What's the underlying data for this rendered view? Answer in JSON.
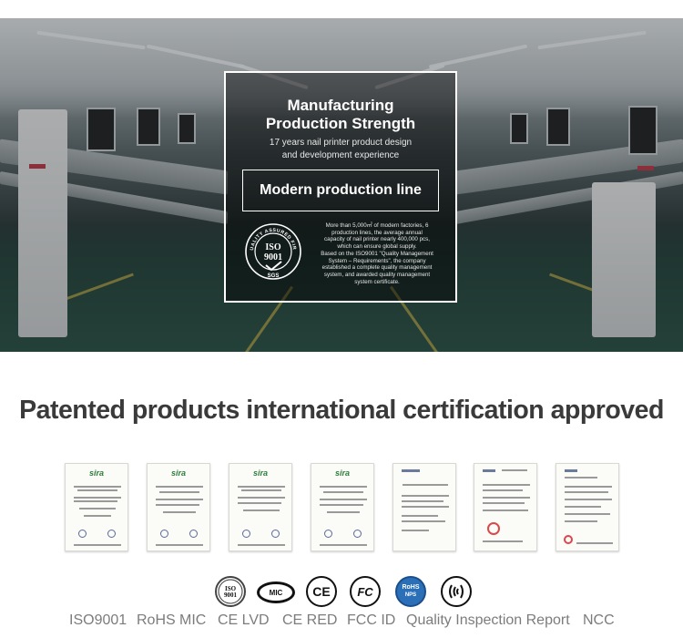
{
  "hero": {
    "title_line1": "Manufacturing",
    "title_line2": "Production Strength",
    "subtitle_line1": "17 years nail printer product design",
    "subtitle_line2": "and development experience",
    "box_label": "Modern production line",
    "seal_top_text": "QUALITY ASSURED FIRM",
    "seal_center_line1": "ISO",
    "seal_center_line2": "9001",
    "seal_bottom_text": "SGS",
    "description_lines": [
      "More than 5,000㎡ of modern factories, 6",
      "production lines, the average annual",
      "capacity of nail printer nearly 400,000 pcs,",
      "which can ensure global supply.",
      "Based on the ISO9001 \"Quality Management",
      "System – Requirements\", the company",
      "established a complete quality management",
      "system, and awarded quality management",
      "system certificate."
    ]
  },
  "section": {
    "heading": "Patented products international certification approved"
  },
  "certificates": [
    {
      "brand": "sira"
    },
    {
      "brand": "sira"
    },
    {
      "brand": "sira"
    },
    {
      "brand": "sira"
    },
    {
      "brand": ""
    },
    {
      "brand": ""
    },
    {
      "brand": ""
    }
  ],
  "badges": {
    "iso_line1": "ISO",
    "iso_line2": "9001",
    "mic": "MIC",
    "ce": "CE",
    "fc": "FC",
    "rohs": "RoHS",
    "nps": "NPS"
  },
  "cert_names": [
    "ISO9001",
    "RoHS",
    "MIC",
    "CE LVD",
    "CE RED",
    "FCC ID",
    "Quality Inspection Report",
    "NCC"
  ],
  "colors": {
    "heading": "#3a3a3a",
    "cert_names": "#7c7c7c",
    "sira_green": "#2e7e3b",
    "rohs_blue": "#2a6fb8"
  }
}
